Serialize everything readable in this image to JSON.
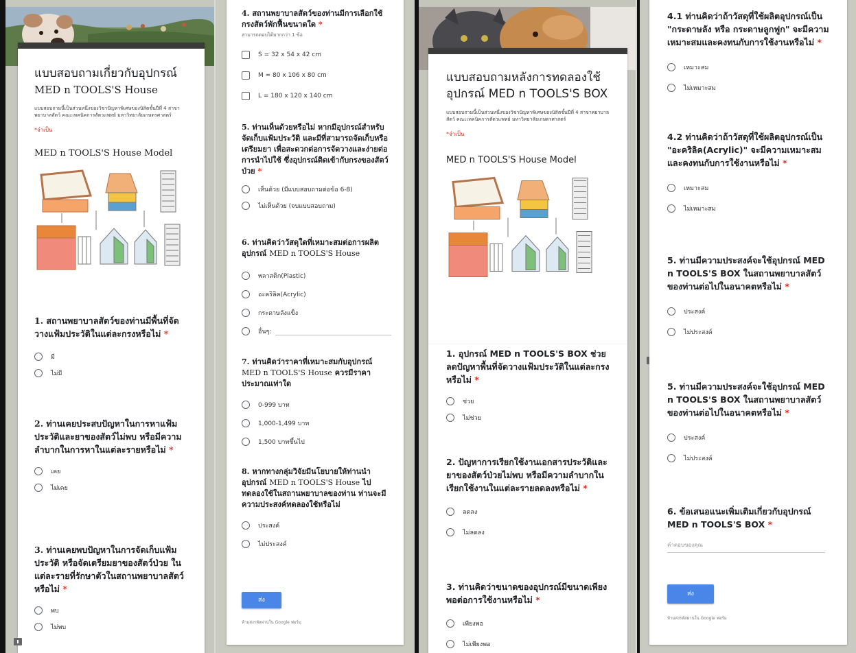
{
  "form1": {
    "title": "แบบสอบถามเกี่ยวกับอุปกรณ์",
    "title_line2": "MED n TOOLS'S House",
    "description": "แบบสอบถามนี้เป็นส่วนหนึ่งของวิชาปัญหาพิเศษของนิสิตชั้นปีที่ 4 สาขาพยาบาลสัตว์ คณะเทคนิคการสัตวแพทย์ มหาวิทยาลัยเกษตรศาสตร์",
    "required_note": "*จำเป็น",
    "model_title": "MED n TOOLS'S House Model",
    "q1": {
      "label": "1. สถานพยาบาลสัตว์ของท่านมีพื้นที่จัดวางแฟ้มประวัติในแต่ละกรงหรือไม่",
      "star": "*",
      "options": [
        "มี",
        "ไม่มี"
      ]
    },
    "q2": {
      "label": "2. ท่านเคยประสบปัญหาในการหาแฟ้มประวัติและยาของสัตว์ไม่พบ หรือมีความลำบากในการหาในแต่ละรายหรือไม่",
      "star": "*",
      "options": [
        "เคย",
        "ไม่เคย"
      ]
    },
    "q3": {
      "label": "3. ท่านเคยพบปัญหาในการจัดเก็บแฟ้มประวัติ หรือจัดเตรียมยาของสัตว์ป่วย ในแต่ละรายที่รักษาตัวในสถานพยาบาลสัตว์หรือไม่",
      "star": "*",
      "options": [
        "พบ",
        "ไม่พบ"
      ]
    },
    "q4": {
      "label": "4. สถานพยาบาลสัตว์ของท่านมีการเลือกใช้กรงสัตว์พักฟื้นขนาดใด",
      "star": "*",
      "hint": "สามารถตอบได้มากกว่า 1 ข้อ",
      "options": [
        "S = 32 x 54 x 42 cm",
        "M = 80 x 106 x 80 cm",
        "L = 180 x 120 x 140 cm"
      ]
    },
    "q5": {
      "label": "5. ท่านเห็นด้วยหรือไม่ หากมีอุปกรณ์สำหรับจัดเก็บแฟ้มประวัติ และมีที่สามารถจัดเก็บหรือเตรียมยา เพื่อสะดวกต่อการจัดวางและง่ายต่อการนำไปใช้ ซึ่งอุปกรณ์ติดเข้ากับกรงของสัตว์ป่วย",
      "star": "*",
      "options": [
        "เห็นด้วย (มีแบบสอบถามต่อข้อ 6-8)",
        "ไม่เห็นด้วย (จบแบบสอบถาม)"
      ]
    },
    "q6": {
      "label": "6. ท่านคิดว่าวัสดุใดที่เหมาะสมต่อการผลิตอุปกรณ์",
      "label_serif": "MED n TOOLS'S House",
      "options": [
        "พลาสติก(Plastic)",
        "อะคริลิค(Acrylic)",
        "กระดาษลังแข็ง"
      ],
      "other": "อื่นๆ:"
    },
    "q7": {
      "label": "7. ท่านคิดว่าราคาที่เหมาะสมกับอุปกรณ์",
      "label_serif": "MED n TOOLS'S House",
      "label_end": "ควรมีราคาประมาณเท่าใด",
      "options": [
        "0-999 บาท",
        "1,000-1,499 บาท",
        "1,500 บาทขึ้นไป"
      ]
    },
    "q8": {
      "label": "8. หากทางกลุ่มวิจัยมีนโยบายให้ท่านนำอุปกรณ์",
      "label_serif": "MED n TOOLS'S House",
      "label_end": "ไปทดลองใช้ในสถานพยาบาลของท่าน ท่านจะมีความประสงค์ทดลองใช้หรือไม่",
      "options": [
        "ประสงค์",
        "ไม่ประสงค์"
      ]
    },
    "submit": "ส่ง",
    "footer": "ห้ามส่งรหัสผ่านใน Google ฟอร์ม"
  },
  "form2": {
    "title": "แบบสอบถามหลังการทดลองใช้อุปกรณ์ MED n TOOLS'S BOX",
    "description": "แบบสอบถามนี้เป็นส่วนหนึ่งของวิชาปัญหาพิเศษของนิสิตชั้นปีที่ 4 สาขาพยาบาลสัตว์ คณะเทคนิคการสัตวแพทย์ มหาวิทยาลัยเกษตรศาสตร์",
    "required_note": "*จำเป็น",
    "model_title": "MED n TOOLS'S House Model",
    "q1": {
      "label": "1. อุปกรณ์ MED n TOOLS'S BOX ช่วยลดปัญหาพื้นที่จัดวางแฟ้มประวัติในแต่ละกรงหรือไม่",
      "star": "*",
      "options": [
        "ช่วย",
        "ไม่ช่วย"
      ]
    },
    "q2": {
      "label": "2. ปัญหาการเรียกใช้งานเอกสารประวัติและยาของสัตว์ป่วยไม่พบ หรือมีความลำบากในเรียกใช้งานในแต่ละรายลดลงหรือไม่",
      "star": "*",
      "options": [
        "ลดลง",
        "ไม่ลดลง"
      ]
    },
    "q3": {
      "label": "3. ท่านคิดว่าขนาดของอุปกรณ์มีขนาดเพียงพอต่อการใช้งานหรือไม่",
      "star": "*",
      "options": [
        "เพียงพอ",
        "ไม่เพียงพอ"
      ]
    },
    "q41": {
      "label": "4.1 ท่านคิดว่าถ้าวัสดุที่ใช้ผลิตอุปกรณ์เป็น \"กระดาษลัง หรือ กระดาษลูกฟูก\" จะมีความเหมาะสมและคงทนกับการใช้งานหรือไม่",
      "star": "*",
      "options": [
        "เหมาะสม",
        "ไม่เหมาะสม"
      ]
    },
    "q42": {
      "label": "4.2 ท่านคิดว่าถ้าวัสดุที่ใช้ผลิตอุปกรณ์เป็น \"อะคริลิค(Acrylic)\" จะมีความเหมาะสมและคงทนกับการใช้งานหรือไม่",
      "star": "*",
      "options": [
        "เหมาะสม",
        "ไม่เหมาะสม"
      ]
    },
    "q5a": {
      "label": "5. ท่านมีความประสงค์จะใช้อุปกรณ์ MED n TOOLS'S BOX ในสถานพยาบาลสัตว์ของท่านต่อไปในอนาคตหรือไม่",
      "star": "*",
      "options": [
        "ประสงค์",
        "ไม่ประสงค์"
      ]
    },
    "q5b": {
      "label": "5. ท่านมีความประสงค์จะใช้อุปกรณ์ MED n TOOLS'S BOX ในสถานพยาบาลสัตว์ของท่านต่อไปในอนาคตหรือไม่",
      "star": "*",
      "options": [
        "ประสงค์",
        "ไม่ประสงค์"
      ]
    },
    "q6": {
      "label": "6. ข้อเสนอแนะเพิ่มเติมเกี่ยวกับอุปกรณ์ MED n TOOLS'S BOX",
      "star": "*",
      "placeholder": "คำตอบของคุณ"
    },
    "submit": "ส่ง",
    "footer": "ห้ามส่งรหัสผ่านใน Google ฟอร์ม"
  },
  "colors": {
    "accent": "#4a86e8",
    "required": "#d93025",
    "frame": "#111111"
  },
  "icons": [
    "feedback-icon",
    "dog-banner",
    "cat-dog-banner",
    "house-model-diagram"
  ]
}
